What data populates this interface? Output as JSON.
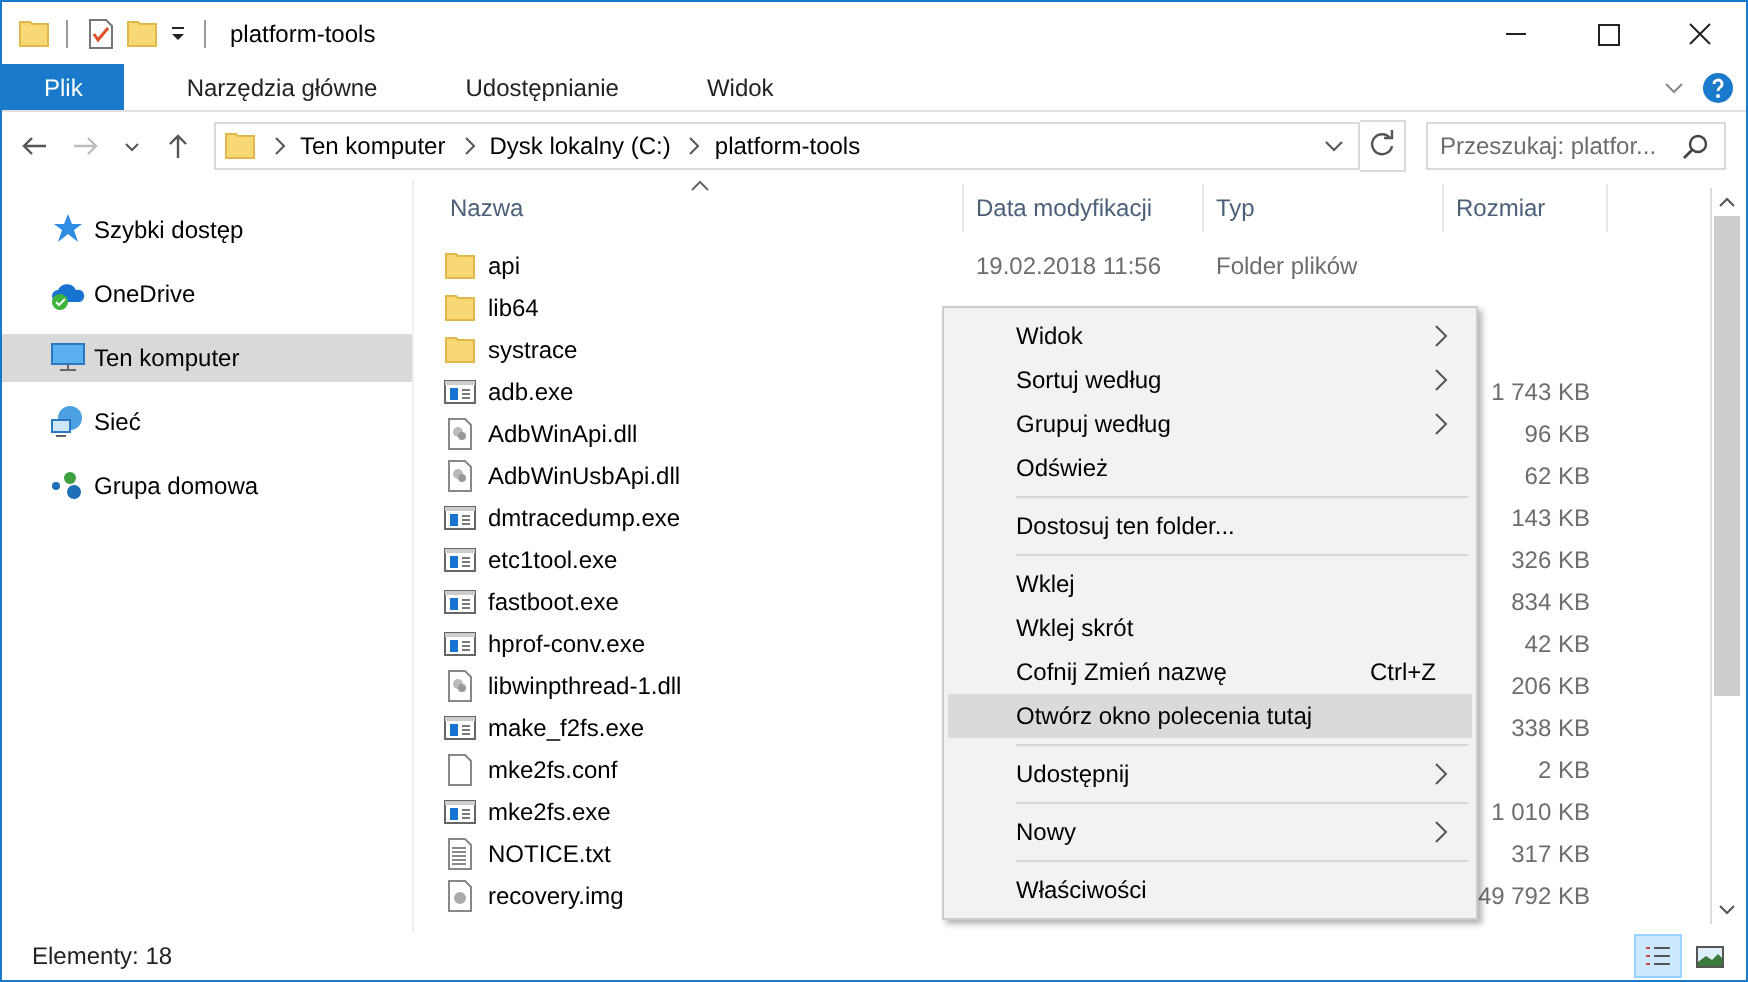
{
  "window": {
    "title": "platform-tools"
  },
  "ribbon_tabs": [
    {
      "label": "Plik",
      "selected": true
    },
    {
      "label": "Narzędzia główne",
      "selected": false
    },
    {
      "label": "Udostępnianie",
      "selected": false
    },
    {
      "label": "Widok",
      "selected": false
    }
  ],
  "address": {
    "crumbs": [
      "Ten komputer",
      "Dysk lokalny (C:)",
      "platform-tools"
    ]
  },
  "search": {
    "placeholder": "Przeszukaj: platfor..."
  },
  "sidebar": {
    "items": [
      {
        "label": "Szybki dostęp",
        "kind": "star",
        "selected": false
      },
      {
        "label": "OneDrive",
        "kind": "cloud",
        "selected": false
      },
      {
        "label": "Ten komputer",
        "kind": "pc",
        "selected": true
      },
      {
        "label": "Sieć",
        "kind": "network",
        "selected": false
      },
      {
        "label": "Grupa domowa",
        "kind": "group",
        "selected": false
      }
    ]
  },
  "table": {
    "columns": [
      "Nazwa",
      "Data modyfikacji",
      "Typ",
      "Rozmiar"
    ],
    "rows": [
      {
        "name": "api",
        "kind": "folder",
        "date": "19.02.2018 11:56",
        "type": "Folder plików"
      },
      {
        "name": "lib64",
        "kind": "folder"
      },
      {
        "name": "systrace",
        "kind": "folder"
      },
      {
        "name": "adb.exe",
        "kind": "exe",
        "size": "1 743 KB"
      },
      {
        "name": "AdbWinApi.dll",
        "kind": "dll",
        "size": "96 KB"
      },
      {
        "name": "AdbWinUsbApi.dll",
        "kind": "dll",
        "size": "62 KB"
      },
      {
        "name": "dmtracedump.exe",
        "kind": "exe",
        "size": "143 KB"
      },
      {
        "name": "etc1tool.exe",
        "kind": "exe",
        "size": "326 KB"
      },
      {
        "name": "fastboot.exe",
        "kind": "exe",
        "size": "834 KB"
      },
      {
        "name": "hprof-conv.exe",
        "kind": "exe",
        "size": "42 KB"
      },
      {
        "name": "libwinpthread-1.dll",
        "kind": "dll",
        "size": "206 KB"
      },
      {
        "name": "make_f2fs.exe",
        "kind": "exe",
        "size": "338 KB"
      },
      {
        "name": "mke2fs.conf",
        "kind": "file",
        "size": "2 KB"
      },
      {
        "name": "mke2fs.exe",
        "kind": "exe",
        "size": "1 010 KB"
      },
      {
        "name": "NOTICE.txt",
        "kind": "txt",
        "size": "317 KB"
      },
      {
        "name": "recovery.img",
        "kind": "img",
        "size": "49 792 KB"
      }
    ]
  },
  "context_menu": {
    "items": [
      {
        "kind": "item",
        "label": "Widok",
        "submenu": true,
        "selected": false
      },
      {
        "kind": "item",
        "label": "Sortuj według",
        "submenu": true,
        "selected": false
      },
      {
        "kind": "item",
        "label": "Grupuj według",
        "submenu": true,
        "selected": false
      },
      {
        "kind": "item",
        "label": "Odśwież",
        "submenu": false,
        "selected": false
      },
      {
        "kind": "separator"
      },
      {
        "kind": "item",
        "label": "Dostosuj ten folder...",
        "submenu": false,
        "selected": false
      },
      {
        "kind": "separator"
      },
      {
        "kind": "item",
        "label": "Wklej",
        "submenu": false,
        "selected": false
      },
      {
        "kind": "item",
        "label": "Wklej skrót",
        "submenu": false,
        "selected": false
      },
      {
        "kind": "item",
        "label": "Cofnij Zmień nazwę",
        "shortcut": "Ctrl+Z",
        "submenu": false,
        "selected": false
      },
      {
        "kind": "item",
        "label": "Otwórz okno polecenia tutaj",
        "submenu": false,
        "selected": true
      },
      {
        "kind": "separator"
      },
      {
        "kind": "item",
        "label": "Udostępnij",
        "submenu": true,
        "selected": false
      },
      {
        "kind": "separator"
      },
      {
        "kind": "item",
        "label": "Nowy",
        "submenu": true,
        "selected": false
      },
      {
        "kind": "separator"
      },
      {
        "kind": "item",
        "label": "Właściwości",
        "submenu": false,
        "selected": false
      }
    ]
  },
  "status_bar": {
    "text": "Elementy: 18",
    "views": [
      {
        "kind": "details",
        "selected": true
      },
      {
        "kind": "large",
        "selected": false
      }
    ]
  }
}
